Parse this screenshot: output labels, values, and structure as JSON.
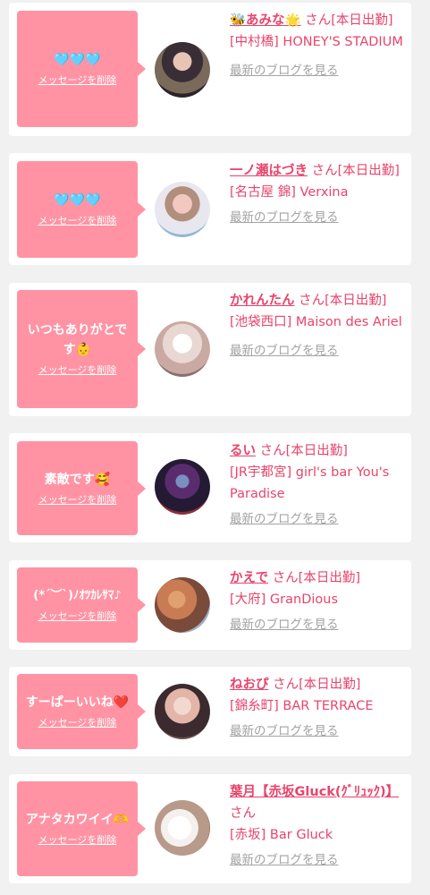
{
  "delete_label": "メッセージを削除",
  "blog_label": "最新のブログを見る",
  "cards": [
    {
      "message": "🩵🩵🩵",
      "name": "🐝あみな🌟",
      "suffix": "さん[本日出勤]",
      "shop": "[中村橋] HONEY'S STADIUM",
      "avatar_colors": [
        "#3a2e36",
        "#c9a08a",
        "#5a4a40"
      ]
    },
    {
      "message": "🩵🩵🩵",
      "name": "一ノ瀬はづき",
      "suffix": "さん[本日出勤]",
      "shop": "[名古屋 錦] Verxina",
      "avatar_colors": [
        "#e8e6ee",
        "#f2c9c0",
        "#8fb8d6"
      ]
    },
    {
      "message": "いつもありがとです👶",
      "name": "かれんたん",
      "suffix": "さん[本日出勤]",
      "shop": "[池袋西口] Maison des Ariel",
      "avatar_colors": [
        "#e9d7d3",
        "#f5f0ee",
        "#c9a9a2"
      ]
    },
    {
      "message": "素敵です🥰",
      "name": "るい",
      "suffix": "さん[本日出勤]",
      "shop": "[JR宇都宮] girl's bar You's Paradise",
      "avatar_colors": [
        "#241a33",
        "#5a2c6e",
        "#8c2f3a"
      ]
    },
    {
      "message": "(*´︶`)ﾉｵﾂｶﾚｻﾏ♪",
      "name": "かえで",
      "suffix": "さん[本日出勤]",
      "shop": "[大府] GranDious",
      "avatar_colors": [
        "#7a4b3a",
        "#c97b53",
        "#9ab0c7"
      ]
    },
    {
      "message": "すーぱーいいね❤️",
      "name": "ねおぴ",
      "suffix": "さん[本日出勤]",
      "shop": "[錦糸町] BAR TERRACE",
      "avatar_colors": [
        "#3b2b2e",
        "#e3b5a8",
        "#f1d9d0"
      ]
    },
    {
      "message": "アナタカワイイ🫶",
      "name": "葉月【赤坂Gluck(ｸﾞﾘｭｯｸ)】",
      "suffix": "さん",
      "shop": "[赤坂] Bar Gluck",
      "avatar_colors": [
        "#b89a8a",
        "#f4f0ee",
        "#8a6b5a"
      ]
    }
  ]
}
